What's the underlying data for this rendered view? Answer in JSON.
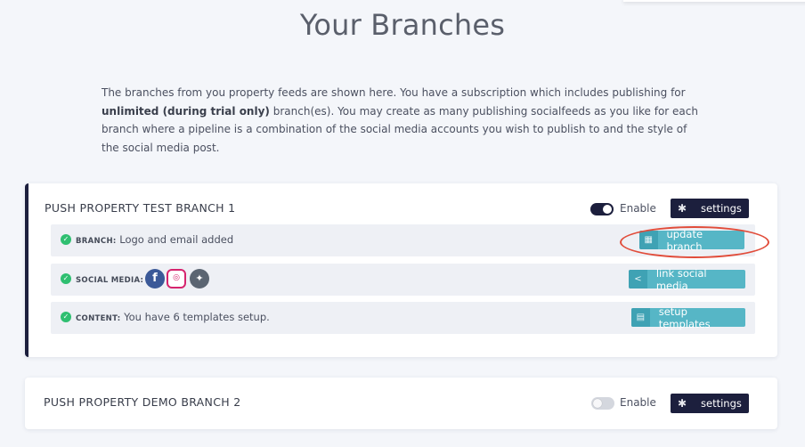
{
  "page": {
    "title": "Your Branches",
    "intro_part1": "The branches from you property feeds are shown here. You have a subscription which includes publishing for",
    "intro_bold": "unlimited (during trial only)",
    "intro_part2": "branch(es). You may create as many publishing socialfeeds as you like for each branch where a pipeline is a combination of the social media accounts you wish to publish to and the style of the social media post."
  },
  "branches": [
    {
      "name": "PUSH PROPERTY TEST BRANCH 1",
      "enabled": true,
      "enable_label": "Enable",
      "settings_label": "settings",
      "settings_icon": "gear-icon",
      "rows": [
        {
          "keyword": "BRANCH:",
          "text": "Logo and email added",
          "button": "update branch",
          "button_icon": "building-icon",
          "status_icon": "check-circle-icon"
        },
        {
          "keyword": "SOCIAL MEDIA:",
          "text": "",
          "icons": [
            "facebook-icon",
            "instagram-icon",
            "twitter-icon"
          ],
          "button": "link social media",
          "button_icon": "share-icon",
          "status_icon": "check-circle-icon"
        },
        {
          "keyword": "CONTENT:",
          "text": "You have 6 templates setup.",
          "button": "setup templates",
          "button_icon": "document-icon",
          "status_icon": "check-circle-icon"
        }
      ]
    },
    {
      "name": "PUSH PROPERTY DEMO BRANCH 2",
      "enabled": false,
      "enable_label": "Enable",
      "settings_label": "settings",
      "settings_icon": "gear-icon"
    }
  ],
  "colors": {
    "navy": "#1c1f3d",
    "teal": "#56b6c6",
    "success": "#2fbf71",
    "highlight": "#e14c3a",
    "background": "#f4f6fa"
  }
}
